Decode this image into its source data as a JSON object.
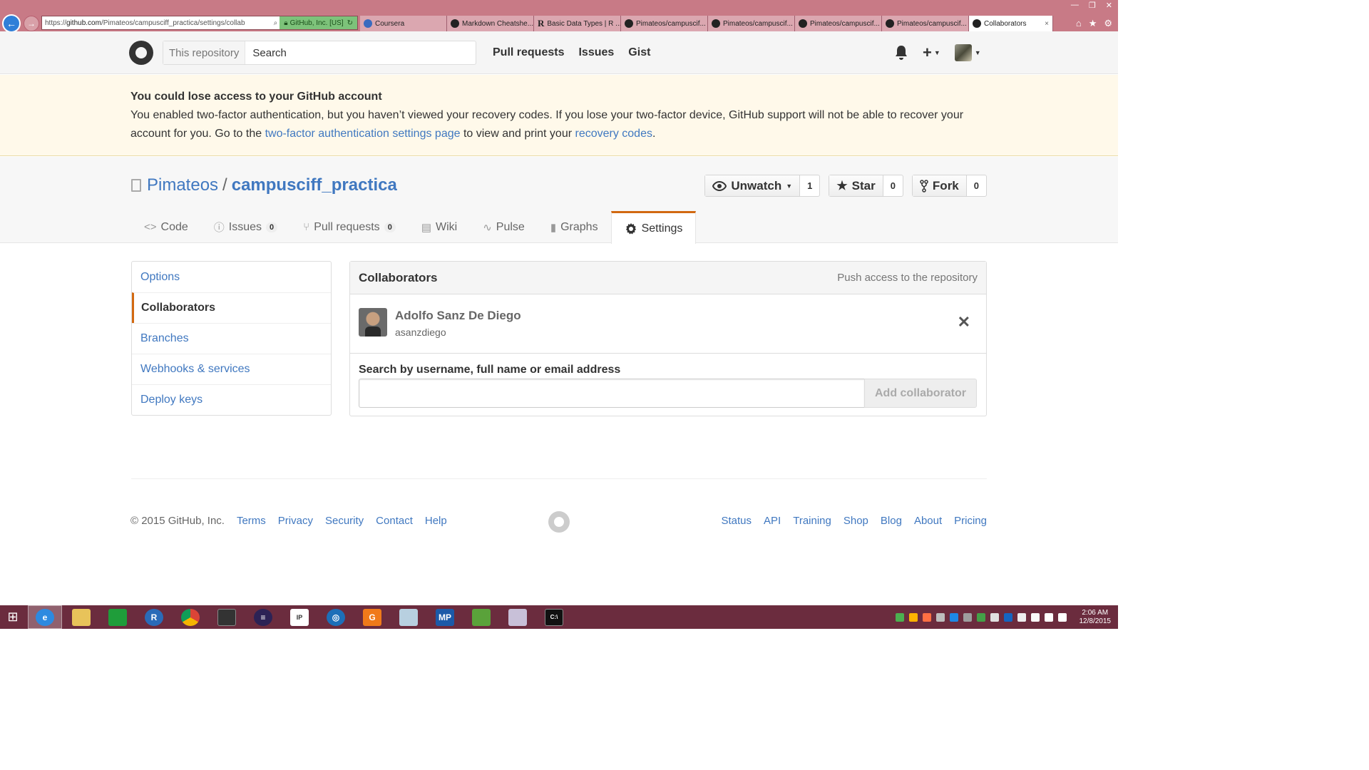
{
  "browser": {
    "url_prefix": "https://",
    "url_host": "github.com",
    "url_path": "/Pimateos/campusciff_practica/settings/collab",
    "secure_label": "GitHub, Inc. [US]",
    "tabs": [
      {
        "label": "Coursera"
      },
      {
        "label": "Markdown Cheatshe..."
      },
      {
        "label": "Basic Data Types | R ..."
      },
      {
        "label": "Pimateos/campuscif..."
      },
      {
        "label": "Pimateos/campuscif..."
      },
      {
        "label": "Pimateos/campuscif..."
      },
      {
        "label": "Pimateos/campuscif..."
      }
    ],
    "active_tab": {
      "label": "Collaborators",
      "close": "×"
    }
  },
  "header": {
    "search_scope": "This repository",
    "search_placeholder": "Search",
    "nav": [
      "Pull requests",
      "Issues",
      "Gist"
    ]
  },
  "flash": {
    "title": "You could lose access to your GitHub account",
    "text_1": "You enabled two-factor authentication, but you haven’t viewed your recovery codes. If you lose your two-factor device, GitHub support will not be able to recover your account for you. Go to the ",
    "link_1": "two-factor authentication settings page",
    "text_2": " to view and print your ",
    "link_2": "recovery codes",
    "text_3": "."
  },
  "repo": {
    "owner": "Pimateos",
    "separator": "/",
    "name": "campusciff_practica",
    "watch_label": "Unwatch",
    "watch_count": "1",
    "star_label": "Star",
    "star_count": "0",
    "fork_label": "Fork",
    "fork_count": "0",
    "tabs": {
      "code": "Code",
      "issues": "Issues",
      "issues_count": "0",
      "pulls": "Pull requests",
      "pulls_count": "0",
      "wiki": "Wiki",
      "pulse": "Pulse",
      "graphs": "Graphs",
      "settings": "Settings"
    }
  },
  "sidebar": {
    "items": [
      {
        "label": "Options"
      },
      {
        "label": "Collaborators"
      },
      {
        "label": "Branches"
      },
      {
        "label": "Webhooks & services"
      },
      {
        "label": "Deploy keys"
      }
    ]
  },
  "collaborators": {
    "title": "Collaborators",
    "note": "Push access to the repository",
    "list": [
      {
        "full_name": "Adolfo Sanz De Diego",
        "username": "asanzdiego"
      }
    ],
    "search_label": "Search by username, full name or email address",
    "search_value": "",
    "add_button": "Add collaborator"
  },
  "footer": {
    "copyright": "© 2015 GitHub, Inc.",
    "left_links": [
      "Terms",
      "Privacy",
      "Security",
      "Contact",
      "Help"
    ],
    "right_links": [
      "Status",
      "API",
      "Training",
      "Shop",
      "Blog",
      "About",
      "Pricing"
    ]
  },
  "taskbar": {
    "time": "2:06 AM",
    "date": "12/8/2015"
  },
  "colors": {
    "link": "#4078c0",
    "accent_orange": "#d26911",
    "flash_bg": "#fff9ea",
    "taskbar": "#6b2c3e",
    "chrome": "#c87a86"
  }
}
